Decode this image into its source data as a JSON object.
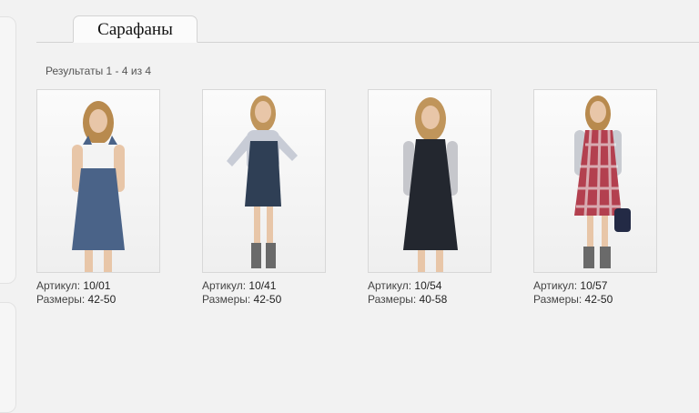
{
  "category": {
    "tab_label": "Сарафаны"
  },
  "results": {
    "text": "Результаты 1 - 4 из 4"
  },
  "labels": {
    "article": "Артикул:",
    "sizes": "Размеры:"
  },
  "products": [
    {
      "article": "10/01",
      "sizes": "42-50",
      "dress_color": "#4a6388",
      "top_color": "#f3f3f3"
    },
    {
      "article": "10/41",
      "sizes": "42-50",
      "dress_color": "#2f3f55",
      "top_color": "#c8ccd6"
    },
    {
      "article": "10/54",
      "sizes": "40-58",
      "dress_color": "#23272f",
      "top_color": "#c6c7cc"
    },
    {
      "article": "10/57",
      "sizes": "42-50",
      "dress_color": "#b3404f",
      "top_color": "#c9ccd2"
    }
  ]
}
